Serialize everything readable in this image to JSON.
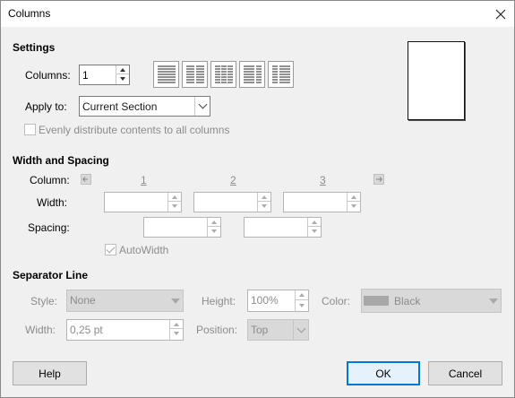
{
  "window": {
    "title": "Columns"
  },
  "settings": {
    "section_title": "Settings",
    "columns_label": "Columns:",
    "columns_value": "1",
    "apply_to_label": "Apply to:",
    "apply_to_value": "Current Section",
    "evenly_label": "Evenly distribute contents to all columns",
    "layouts": [
      "1 column",
      "2 columns",
      "3 columns",
      "2 columns left larger",
      "2 columns right larger"
    ]
  },
  "width_spacing": {
    "section_title": "Width and Spacing",
    "column_label": "Column:",
    "column_numbers": [
      "1",
      "2",
      "3"
    ],
    "width_label": "Width:",
    "spacing_label": "Spacing:",
    "autowidth_label": "AutoWidth",
    "autowidth_checked": true
  },
  "separator": {
    "section_title": "Separator Line",
    "style_label": "Style:",
    "style_value": "None",
    "height_label": "Height:",
    "height_value": "100%",
    "color_label": "Color:",
    "color_value": "Black",
    "color_swatch": "#a8a8a8",
    "width_label": "Width:",
    "width_value": "0,25 pt",
    "position_label": "Position:",
    "position_value": "Top"
  },
  "buttons": {
    "help": "Help",
    "ok": "OK",
    "cancel": "Cancel"
  },
  "colors": {
    "default_button_border": "#0078d7",
    "disabled_text": "#8c8c8c"
  }
}
